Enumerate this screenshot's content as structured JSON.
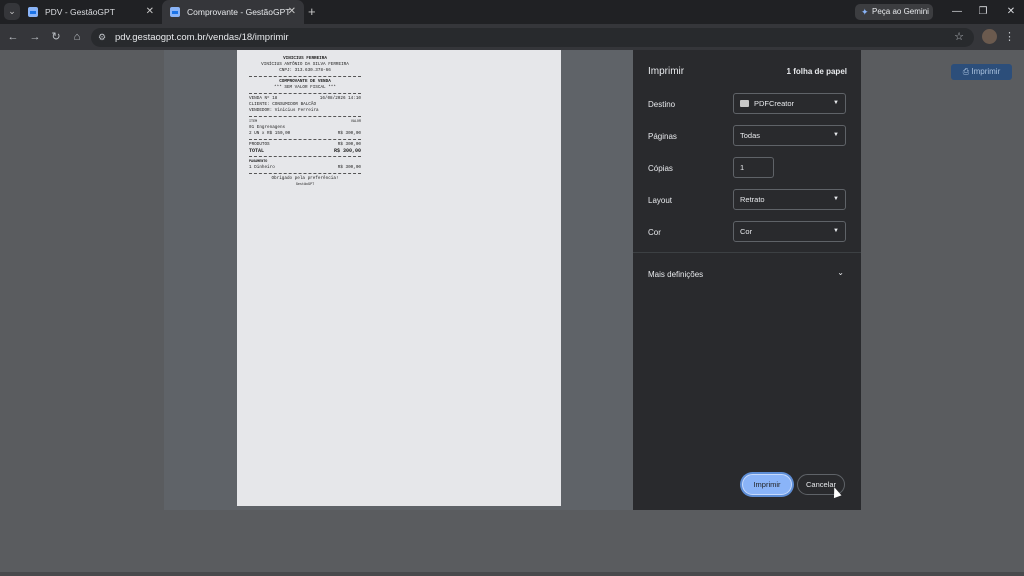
{
  "browser": {
    "tabs": [
      {
        "title": "PDV - GestãoGPT",
        "active": false
      },
      {
        "title": "Comprovante - GestãoGPT",
        "active": true
      }
    ],
    "new_tab": "+",
    "gemini_label": "Peça ao Gemini",
    "url": "pdv.gestaogpt.com.br/vendas/18/imprimir",
    "window_controls": {
      "minimize": "—",
      "restore": "❐",
      "close": "✕"
    }
  },
  "page": {
    "print_button_label": "Imprimir"
  },
  "receipt": {
    "name": "VINICIUS FERREIRA",
    "full_name": "VINÍCIUS ANTÔNIO DA SILVA FERREIRA",
    "cnpj": "CNPJ: 313.630.378-66",
    "doc_title": "COMPROVANTE DE VENDA",
    "fiscal_note": "*** SEM VALOR FISCAL ***",
    "sale_no": "VENDA Nº 18",
    "sale_date": "16/08/2026 14:10",
    "client": "CLIENTE: CONSUMIDOR BALCÃO",
    "seller": "VENDEDOR: Vinicius Ferreira",
    "col_item": "ITEM",
    "col_value": "VALOR",
    "item_name": "01 Engrenagens",
    "item_qty": "2 UN x R$ 150,00",
    "item_total": "R$ 300,00",
    "products_label": "PRODUTOS",
    "products_value": "R$ 300,00",
    "total_label": "TOTAL",
    "total_value": "R$ 300,00",
    "payment_label": "PAGAMENTO",
    "payment_method": "1 Dinheiro",
    "payment_value": "R$ 300,00",
    "thanks": "Obrigado pela preferência!",
    "brand": "GestãoGPT"
  },
  "print_dialog": {
    "title": "Imprimir",
    "sheet_count": "1 folha de papel",
    "destination_label": "Destino",
    "destination_value": "PDFCreator",
    "pages_label": "Páginas",
    "pages_value": "Todas",
    "copies_label": "Cópias",
    "copies_value": "1",
    "layout_label": "Layout",
    "layout_value": "Retrato",
    "color_label": "Cor",
    "color_value": "Cor",
    "more_settings": "Mais definições",
    "print_button": "Imprimir",
    "cancel_button": "Cancelar"
  }
}
